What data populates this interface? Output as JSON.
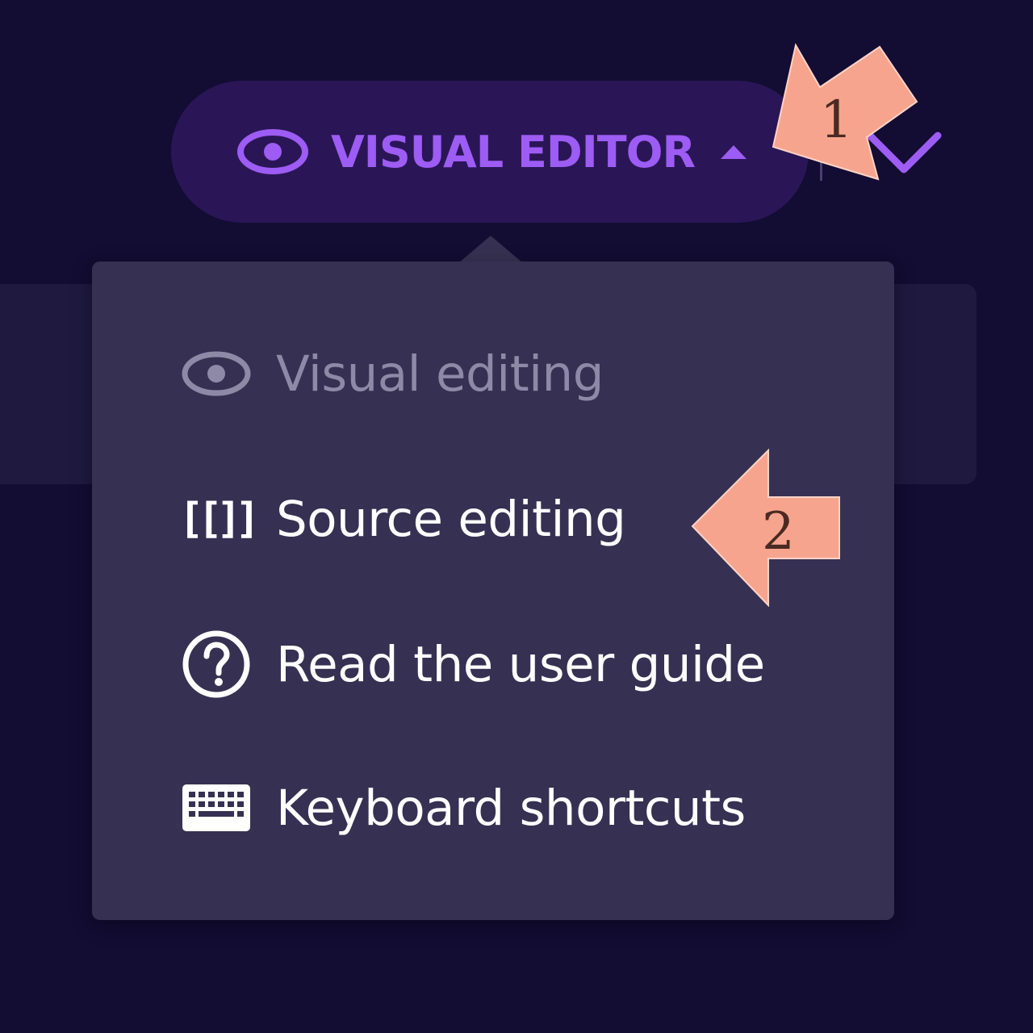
{
  "toolbar": {
    "editor_switch": {
      "label": "VISUAL EDITOR",
      "icon": "eye-icon",
      "caret": "caret-up-icon"
    },
    "more_button": {
      "icon": "chevron-down-icon"
    }
  },
  "menu": {
    "items": [
      {
        "label": "Visual editing",
        "icon": "eye-icon",
        "state": "disabled"
      },
      {
        "label": "Source editing",
        "icon": "[[]]",
        "state": "enabled"
      },
      {
        "label": "Read the user guide",
        "icon": "question-circle-icon",
        "state": "enabled"
      },
      {
        "label": "Keyboard shortcuts",
        "icon": "keyboard-icon",
        "state": "enabled"
      }
    ]
  },
  "annotations": [
    {
      "number": "1",
      "target": "editor-switch"
    },
    {
      "number": "2",
      "target": "menu-item-source-editing"
    }
  ],
  "colors": {
    "background": "#130c33",
    "pill": "#2a1656",
    "accent": "#9d5cf4",
    "menu": "#363152",
    "disabled_text": "#8e89a6",
    "annotation": "#f7a48e"
  }
}
